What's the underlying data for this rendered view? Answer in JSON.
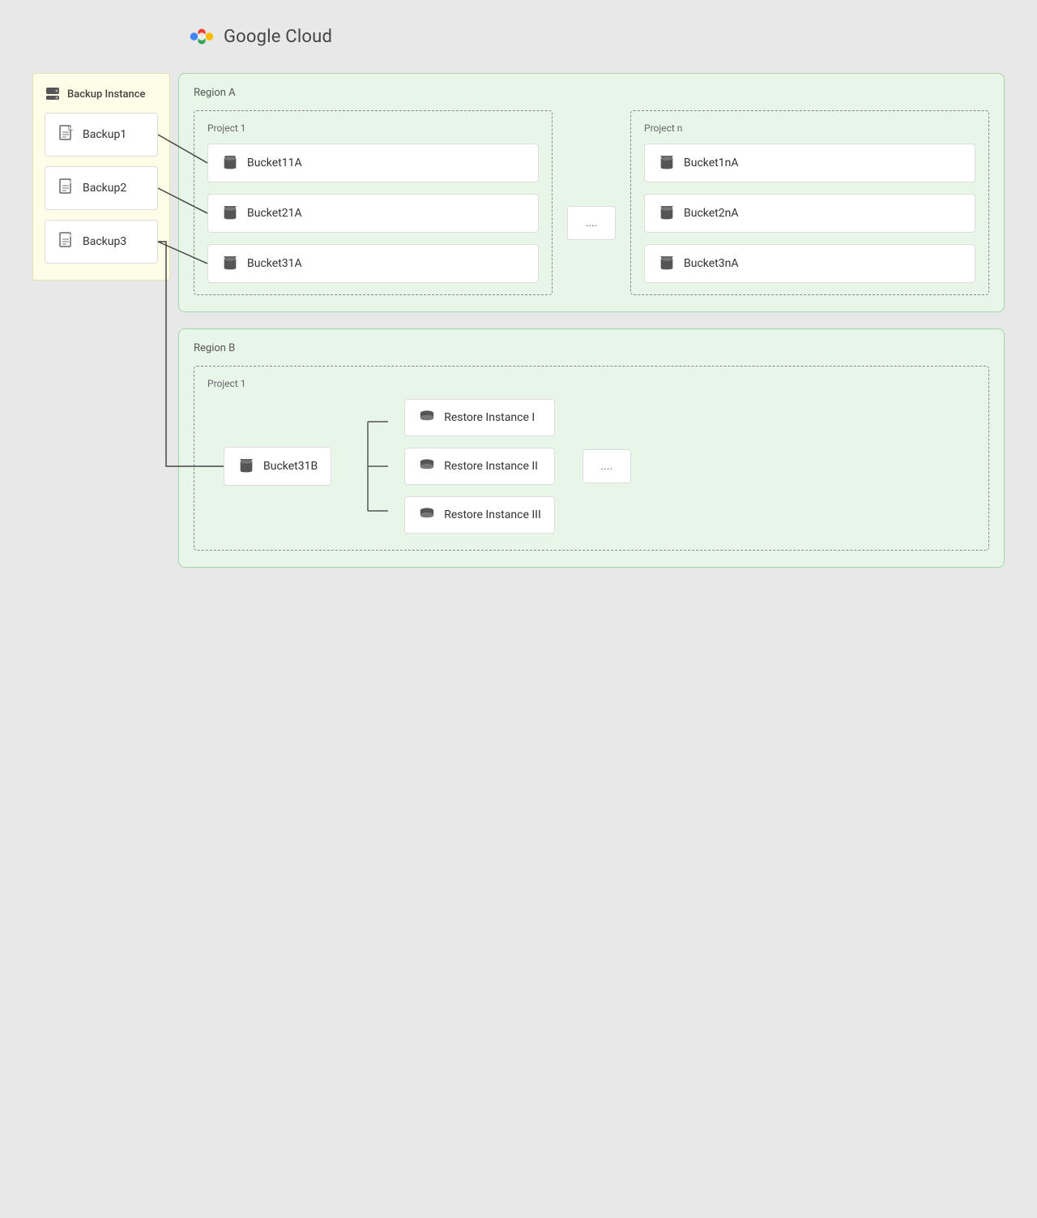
{
  "header": {
    "logo_text": "Google Cloud"
  },
  "backup_panel": {
    "title": "Backup Instance",
    "items": [
      {
        "label": "Backup1",
        "id": "backup1"
      },
      {
        "label": "Backup2",
        "id": "backup2"
      },
      {
        "label": "Backup3",
        "id": "backup3"
      }
    ]
  },
  "region_a": {
    "label": "Region A",
    "projects": [
      {
        "label": "Project 1",
        "buckets": [
          {
            "label": "Bucket11A"
          },
          {
            "label": "Bucket21A"
          },
          {
            "label": "Bucket31A"
          }
        ]
      },
      {
        "label": "...",
        "buckets": []
      },
      {
        "label": "Project n",
        "buckets": [
          {
            "label": "Bucket1nA"
          },
          {
            "label": "Bucket2nA"
          },
          {
            "label": "Bucket3nA"
          }
        ]
      }
    ]
  },
  "region_b": {
    "label": "Region B",
    "project_label": "Project 1",
    "bucket": {
      "label": "Bucket31B"
    },
    "restore_instances": [
      {
        "label": "Restore Instance I"
      },
      {
        "label": "Restore Instance II"
      },
      {
        "label": "Restore Instance III"
      }
    ],
    "ellipsis": "...."
  },
  "ellipsis_middle": "....",
  "ellipsis_restore": "...."
}
